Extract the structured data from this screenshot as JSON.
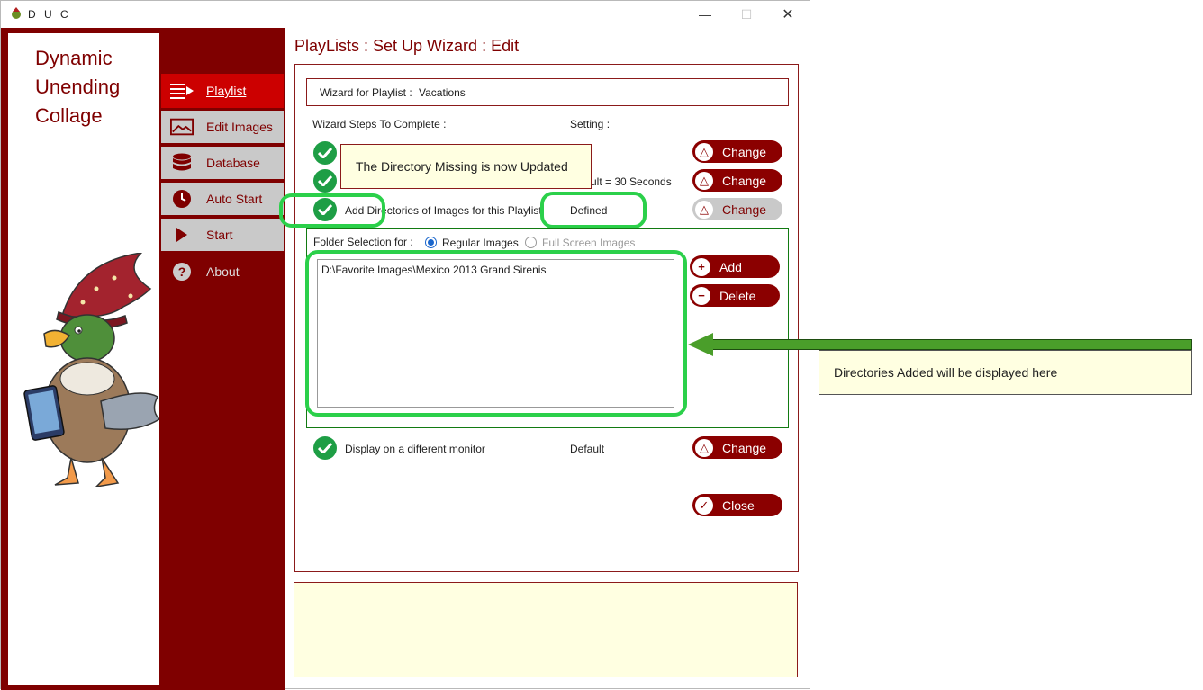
{
  "window": {
    "title": "D U C",
    "controls": {
      "minimize": "—",
      "maximize": "☐",
      "close": "✕"
    }
  },
  "brand": {
    "line1": "Dynamic",
    "line2": "Unending",
    "line3": "Collage"
  },
  "nav": {
    "items": [
      {
        "label": "Playlist",
        "icon": "playlist-icon",
        "state": "active"
      },
      {
        "label": "Edit Images",
        "icon": "image-icon",
        "state": "normal"
      },
      {
        "label": "Database",
        "icon": "database-icon",
        "state": "normal"
      },
      {
        "label": "Auto Start",
        "icon": "clock-icon",
        "state": "normal"
      },
      {
        "label": "Start",
        "icon": "play-icon",
        "state": "normal"
      },
      {
        "label": "About",
        "icon": "help-icon",
        "state": "normal"
      }
    ]
  },
  "page": {
    "title": "PlayLists : Set Up Wizard : Edit"
  },
  "wizard": {
    "name_label": "Wizard for Playlist :",
    "name_value": "Vacations",
    "steps_header": "Wizard Steps To Complete :",
    "setting_header": "Setting :",
    "step2_setting": "ult = 30 Seconds",
    "step3_label": "Add Directories of Images for this Playlist",
    "step3_setting": "Defined",
    "step4_label": "Display on a different monitor",
    "step4_setting": "Default",
    "change_label": "Change",
    "close_label": "Close"
  },
  "tooltip": {
    "text": "The Directory Missing is now Updated"
  },
  "folders": {
    "label": "Folder Selection for :",
    "option_regular": "Regular Images",
    "option_fullscreen": "Full Screen Images",
    "selected": "Regular Images",
    "items": [
      "D:\\Favorite Images\\Mexico 2013 Grand Sirenis"
    ],
    "add_label": "Add",
    "delete_label": "Delete"
  },
  "annotation": {
    "text": "Directories Added will be displayed here"
  },
  "colors": {
    "brand": "#7f0000",
    "active_nav": "#cc0000",
    "check": "#1e9e45",
    "highlight": "#2bd04a",
    "note_bg": "#ffffe1"
  }
}
